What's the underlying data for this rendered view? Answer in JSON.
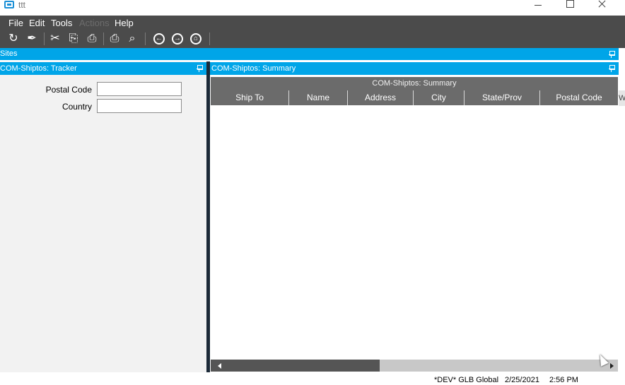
{
  "window": {
    "title": "ttt"
  },
  "menu": {
    "items": [
      "File",
      "Edit",
      "Tools",
      "Actions",
      "Help"
    ]
  },
  "toolbar": {
    "icons": [
      "refresh-icon",
      "clear-icon",
      "cut-icon",
      "copy-icon",
      "paste-icon",
      "print-icon",
      "print-preview-icon",
      "back-icon",
      "forward-icon",
      "home-icon"
    ]
  },
  "sites": {
    "label": "Sites"
  },
  "tracker": {
    "header": "COM-Shiptos: Tracker",
    "postal_code_label": "Postal Code",
    "postal_code_value": "",
    "country_label": "Country",
    "country_value": ""
  },
  "summary": {
    "header": "COM-Shiptos: Summary",
    "grid_title": "COM-Shiptos: Summary",
    "columns": [
      "Ship To",
      "Name",
      "Address",
      "City",
      "State/Prov",
      "Postal Code"
    ],
    "overflow_col_fragment": "W",
    "scroll_position": 0
  },
  "status": {
    "environment": "*DEV* GLB Global",
    "date": "2/25/2021",
    "time": "2:56 PM"
  },
  "colors": {
    "accent": "#00a5e8",
    "menubar": "#4b4b4b",
    "grid_header": "#6b6b6b",
    "splitter": "#1c2a38"
  }
}
